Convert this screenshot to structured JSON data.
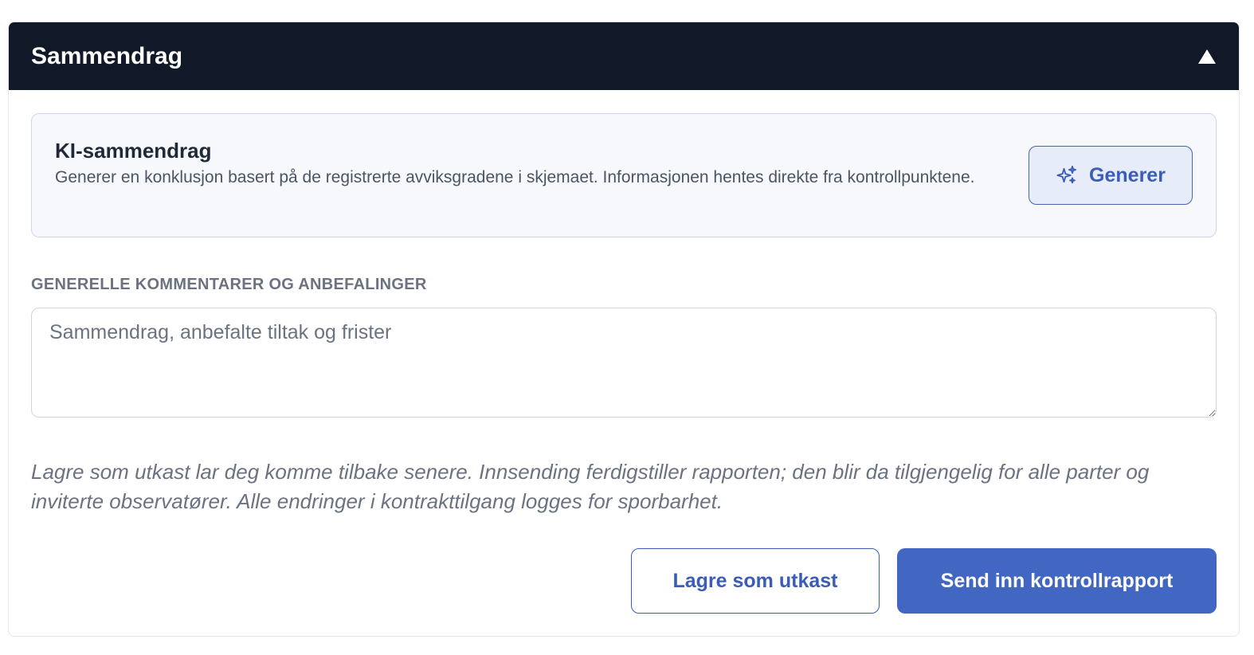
{
  "header": {
    "title": "Sammendrag",
    "collapse_icon": "caret-up-icon"
  },
  "ai_summary": {
    "title": "KI-sammendrag",
    "description": "Generer en konklusjon basert på de registrerte avviksgradene i skjemaet. Informasjonen hentes direkte fra kontrollpunktene.",
    "generate_label": "Generer",
    "generate_icon": "sparkle-icon"
  },
  "comments": {
    "label": "GENERELLE KOMMENTARER OG ANBEFALINGER",
    "value": "",
    "placeholder": "Sammendrag, anbefalte tiltak og frister"
  },
  "info_text": "Lagre som utkast lar deg komme tilbake senere. Innsending ferdigstiller rapporten; den blir da tilgjengelig for alle parter og inviterte observatører. Alle endringer i kontrakttilgang logges for sporbarhet.",
  "actions": {
    "draft_label": "Lagre som utkast",
    "submit_label": "Send inn kontrollrapport"
  },
  "colors": {
    "header_bg": "#111827",
    "accent": "#4267c2",
    "ai_box_bg": "#f6f8fc"
  }
}
